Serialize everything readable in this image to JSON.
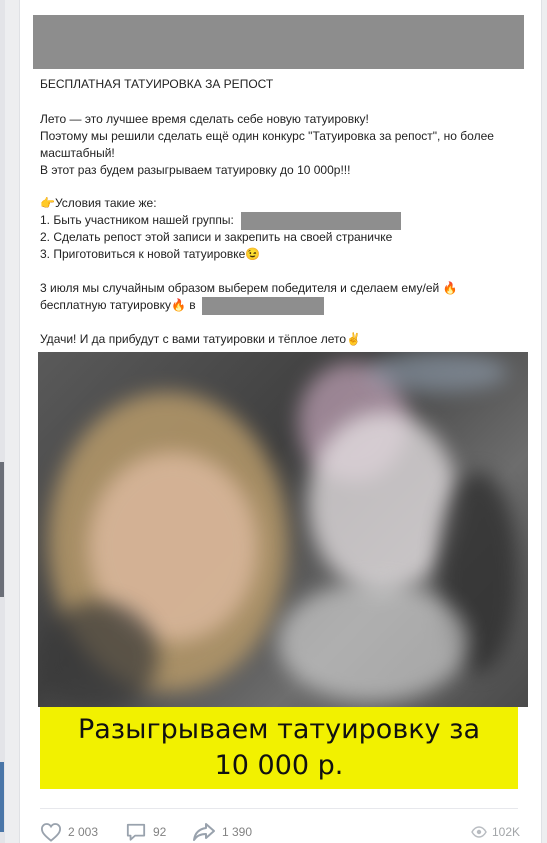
{
  "post": {
    "title": "БЕСПЛАТНАЯ ТАТУИРОВКА ЗА РЕПОСТ",
    "paragraph1": [
      "Лето — это лучшее время сделать себе новую татуировку!",
      "Поэтому мы решили сделать ещё один конкурс \"Татуировка за репост\", но более",
      "масштабный!",
      "В этот раз будем разыгрываем татуировку до 10 000р!!!"
    ],
    "conditions_emoji": "👉",
    "conditions_title": "Условия такие же:",
    "condition1": "1. Быть участником нашей группы:",
    "condition2": "2. Сделать репост этой записи и закрепить на своей страничке",
    "condition3": "3. Приготовиться к новой татуировке",
    "wink_emoji": "😉",
    "draw_line1": "3 июля мы случайным образом выберем победителя и сделаем ему/ей",
    "fire_emoji": "🔥",
    "draw_line2_start": "бесплатную татуировку",
    "draw_line2_in": "в",
    "closing": "Удачи! И да прибудут с вами татуировки и тёплое лето",
    "closing_emoji": "✌"
  },
  "banner": {
    "line1": "Разыгрываем татуировку за",
    "line2": "10 000 р."
  },
  "actions": {
    "likes": "2 003",
    "comments": "92",
    "reposts": "1 390",
    "views": "102K"
  },
  "colors": {
    "banner_bg": "#f2f100",
    "page_bg": "#edeef0",
    "action_text": "#828282"
  }
}
